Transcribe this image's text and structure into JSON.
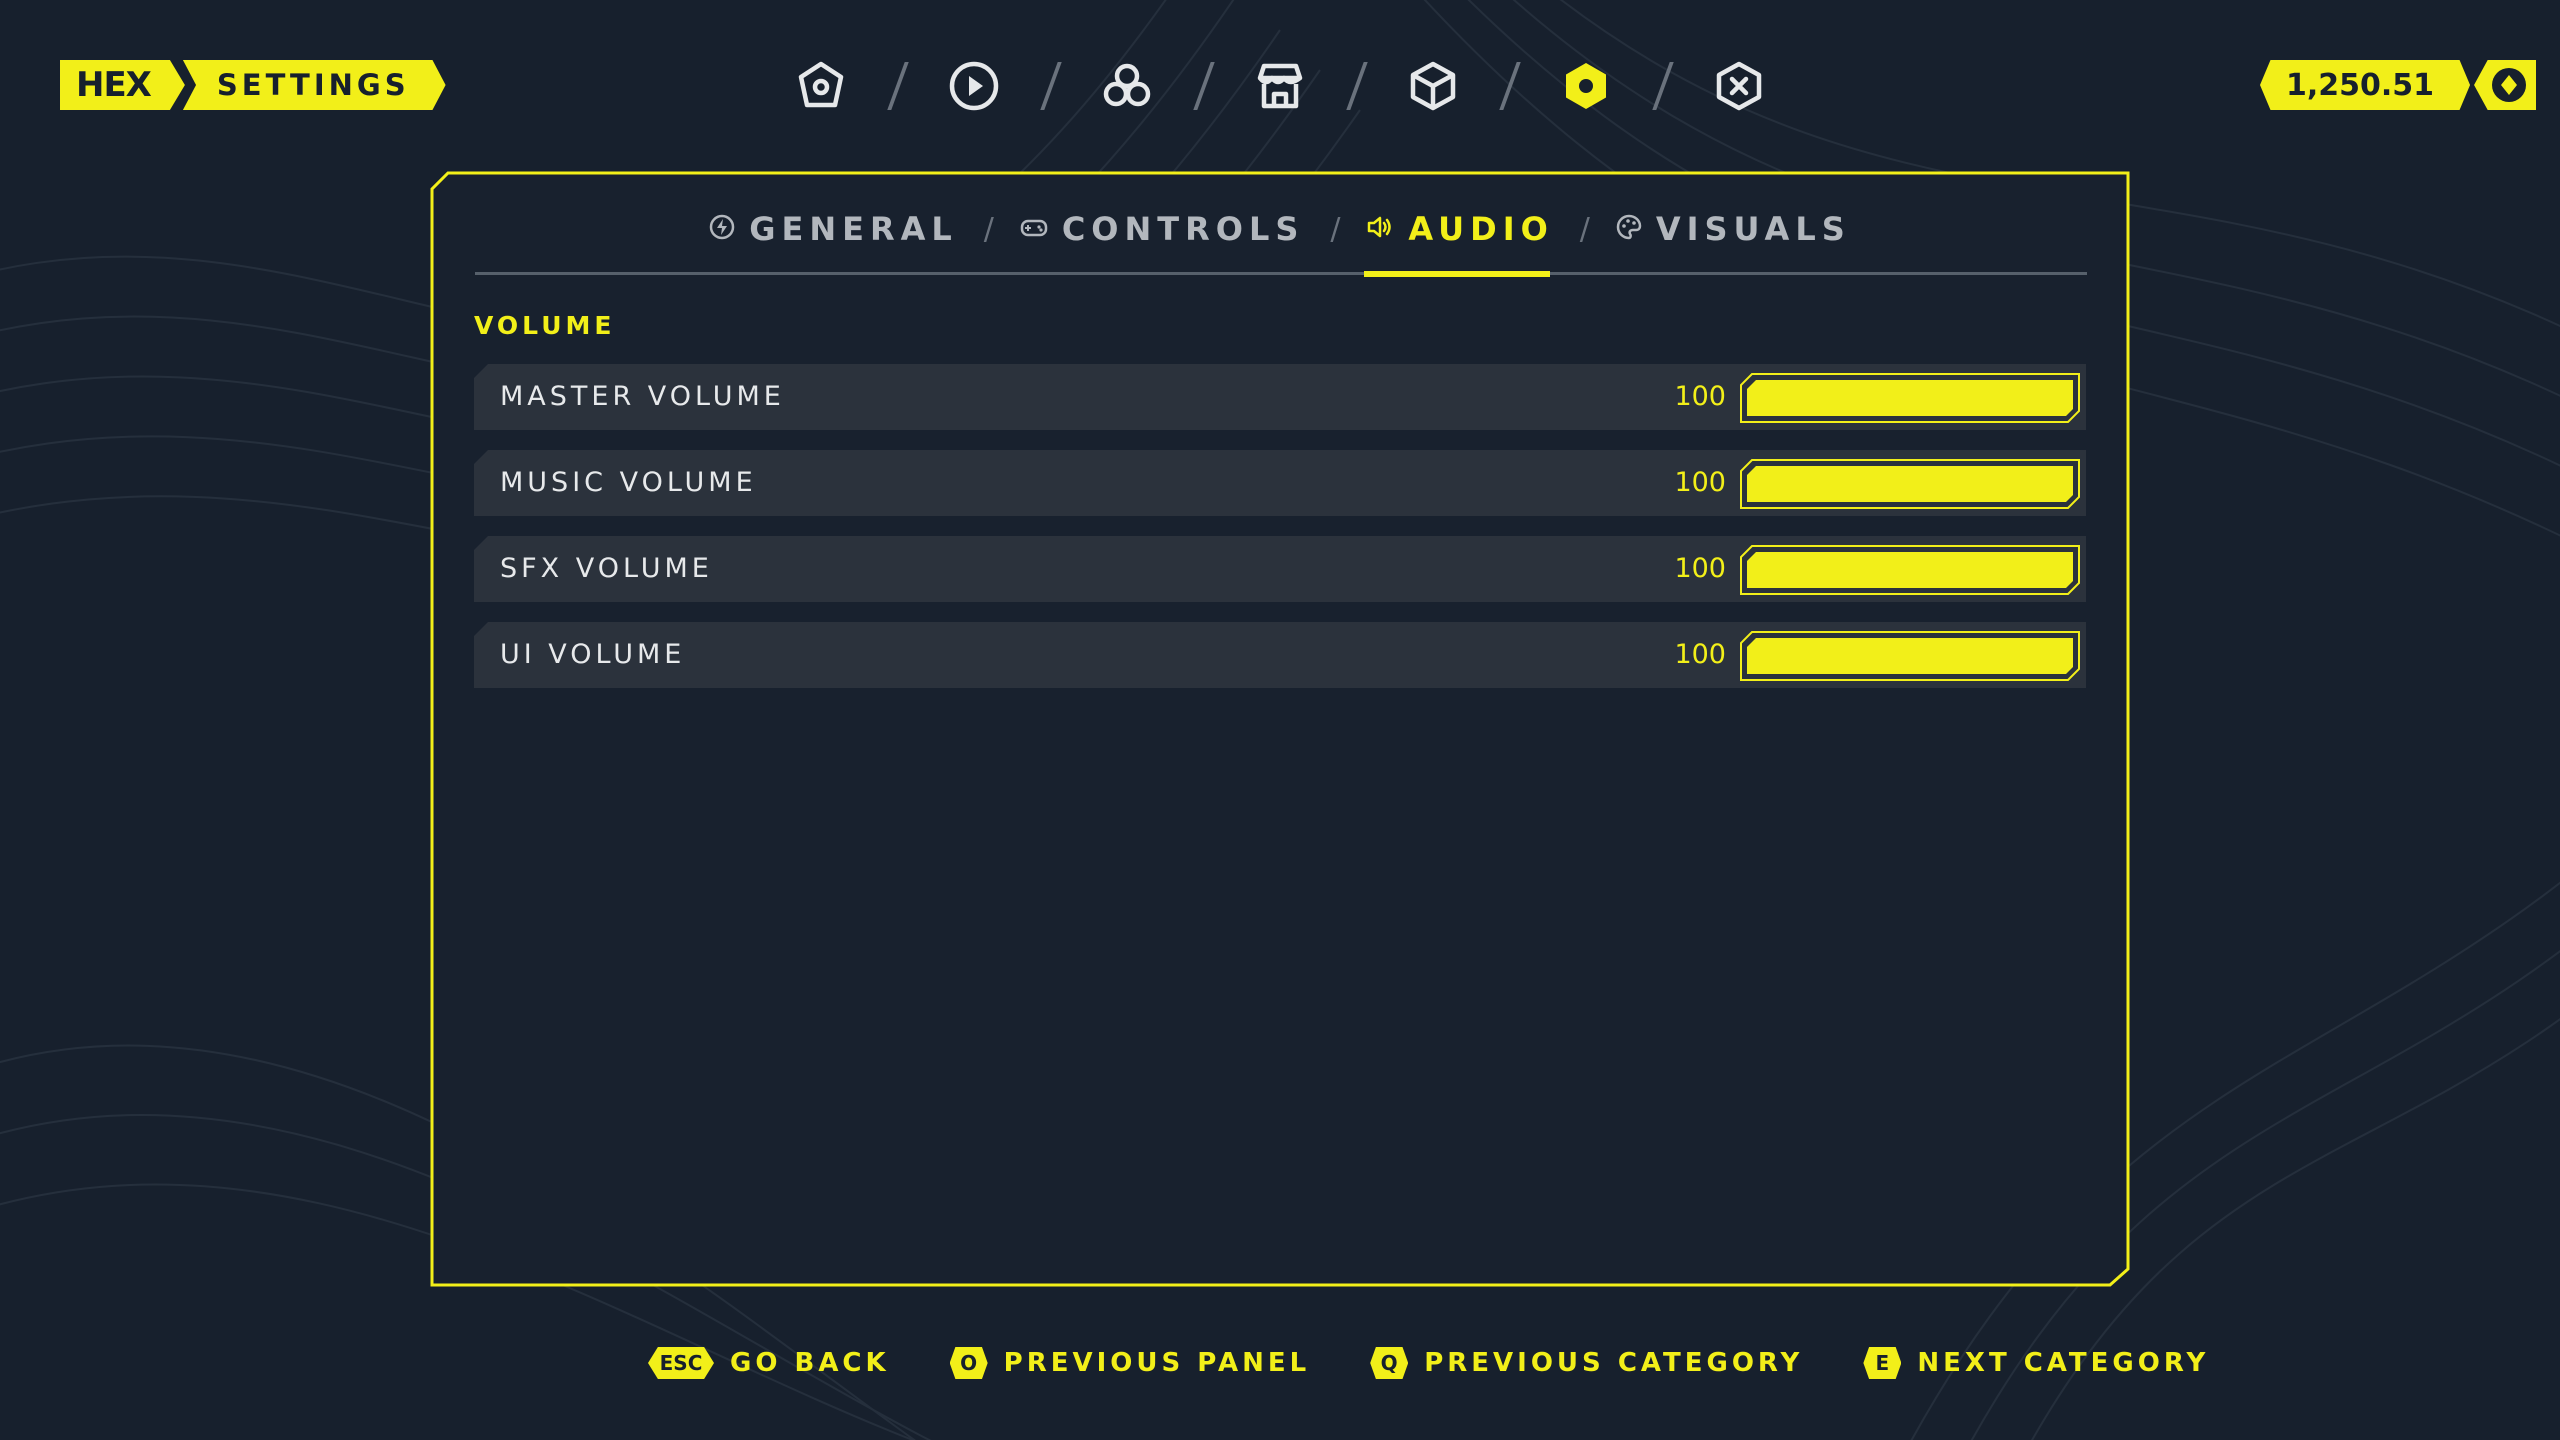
{
  "brand": {
    "logo": "HEX",
    "title": "SETTINGS"
  },
  "topnav": {
    "items": [
      {
        "icon": "home-icon",
        "active": false
      },
      {
        "icon": "play-icon",
        "active": false
      },
      {
        "icon": "community-icon",
        "active": false
      },
      {
        "icon": "store-icon",
        "active": false
      },
      {
        "icon": "inventory-cube-icon",
        "active": false
      },
      {
        "icon": "settings-icon",
        "active": true
      },
      {
        "icon": "quit-icon",
        "active": false
      }
    ]
  },
  "currency": {
    "amount": "1,250.51",
    "icon": "coin-icon"
  },
  "tabs": [
    {
      "label": "GENERAL",
      "icon": "bolt-icon",
      "active": false
    },
    {
      "label": "CONTROLS",
      "icon": "gamepad-icon",
      "active": false
    },
    {
      "label": "AUDIO",
      "icon": "speaker-icon",
      "active": true
    },
    {
      "label": "VISUALS",
      "icon": "palette-icon",
      "active": false
    }
  ],
  "section": {
    "title": "VOLUME"
  },
  "settings": [
    {
      "label": "MASTER VOLUME",
      "value": "100",
      "level": 1.0
    },
    {
      "label": "MUSIC VOLUME",
      "value": "100",
      "level": 1.0
    },
    {
      "label": "SFX VOLUME",
      "value": "100",
      "level": 1.0
    },
    {
      "label": "UI VOLUME",
      "value": "100",
      "level": 1.0
    }
  ],
  "hints": [
    {
      "key": "ESC",
      "label": "GO BACK"
    },
    {
      "key": "O",
      "label": "PREVIOUS PANEL"
    },
    {
      "key": "Q",
      "label": "PREVIOUS CATEGORY"
    },
    {
      "key": "E",
      "label": "NEXT CATEGORY"
    }
  ],
  "colors": {
    "accent": "#f2ef19",
    "background": "#17202d",
    "row": "#2b323c",
    "muted": "#b2b7bd"
  }
}
